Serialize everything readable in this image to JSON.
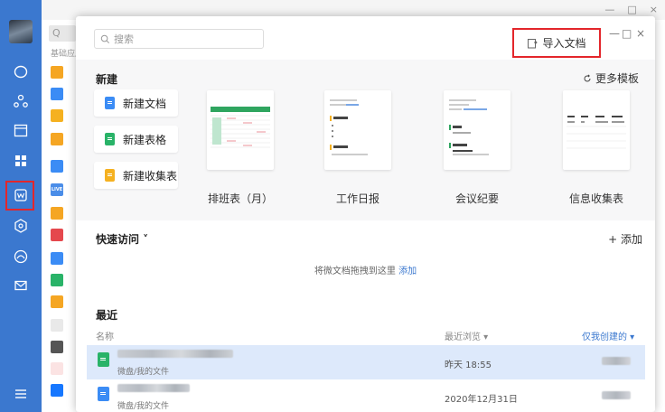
{
  "window": {
    "controls": [
      "—",
      "□",
      "×"
    ]
  },
  "background": {
    "search_placeholder": "Q",
    "section_label": "基础应用"
  },
  "dialog": {
    "search_placeholder": "搜索",
    "import_button": "导入文档",
    "controls": [
      "—",
      "□",
      "×"
    ],
    "new_section": {
      "title": "新建",
      "more_templates": "更多模板",
      "buttons": [
        {
          "label": "新建文档",
          "color": "#3b8cf5"
        },
        {
          "label": "新建表格",
          "color": "#29b368"
        },
        {
          "label": "新建收集表",
          "color": "#f5b120"
        }
      ],
      "templates": [
        {
          "label": "排班表（月）"
        },
        {
          "label": "工作日报"
        },
        {
          "label": "会议纪要"
        },
        {
          "label": "信息收集表"
        }
      ]
    },
    "quick_access": {
      "title": "快速访问 ˅",
      "add": "+ 添加",
      "hint": "将微文档拖拽到这里",
      "hint_link": "添加"
    },
    "recent": {
      "title": "最近",
      "columns": {
        "name": "名称",
        "browsed": "最近浏览 ▾",
        "filter": "仅我创建的 ▾"
      },
      "rows": [
        {
          "path": "微盘/我的文件",
          "time": "昨天 18:55",
          "icon_color": "#29b368"
        },
        {
          "path": "微盘/我的文件",
          "time": "2020年12月31日",
          "icon_color": "#3b8cf5"
        }
      ]
    }
  },
  "colors": {
    "accent": "#3b78cf",
    "highlight": "#e3262b",
    "selected_row": "#dde9fb"
  }
}
